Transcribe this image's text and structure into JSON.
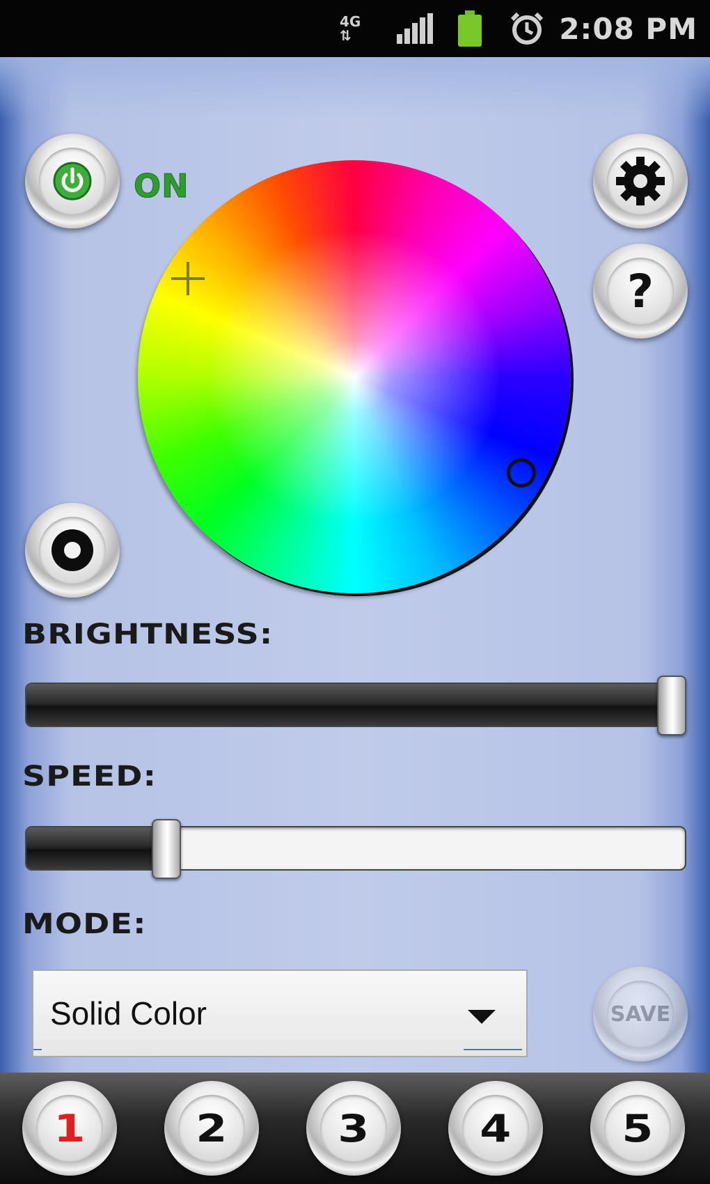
{
  "status_bar": {
    "network": "4G",
    "network_arrows": "⇅",
    "time": "2:08 PM",
    "icons": [
      "signal-icon",
      "battery-icon",
      "alarm-icon"
    ]
  },
  "controls": {
    "power_state": "ON",
    "power_icon": "power-icon",
    "settings_icon": "gear-icon",
    "help_label": "?",
    "view_icon": "target-icon"
  },
  "brightness": {
    "label": "BRIGHTNESS:",
    "value_fraction": 1.0
  },
  "speed": {
    "label": "SPEED:",
    "value_fraction": 0.2
  },
  "mode": {
    "label": "MODE:",
    "selected": "Solid Color"
  },
  "save": {
    "label": "SAVE",
    "enabled": false
  },
  "presets": [
    {
      "label": "1",
      "active": true
    },
    {
      "label": "2",
      "active": false
    },
    {
      "label": "3",
      "active": false
    },
    {
      "label": "4",
      "active": false
    },
    {
      "label": "5",
      "active": false
    }
  ],
  "colors": {
    "accent_active": "#e02020",
    "on_green": "#2f9c2f",
    "background": "#c0cbea"
  }
}
